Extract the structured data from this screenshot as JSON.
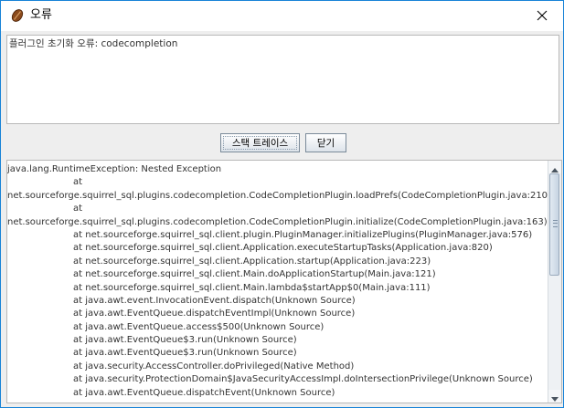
{
  "window": {
    "title": "오류",
    "icon": "coffee-bean-icon",
    "close": "close-icon"
  },
  "message": "플러그인 초기화 오류: codecompletion",
  "buttons": {
    "stack_trace": "스택 트레이스",
    "close": "닫기"
  },
  "trace": [
    {
      "text": "java.lang.RuntimeException: Nested Exception",
      "indent": false
    },
    {
      "text": "at",
      "indent": true
    },
    {
      "text": "net.sourceforge.squirrel_sql.plugins.codecompletion.CodeCompletionPlugin.loadPrefs(CodeCompletionPlugin.java:210)",
      "indent": false
    },
    {
      "text": "at",
      "indent": true
    },
    {
      "text": "net.sourceforge.squirrel_sql.plugins.codecompletion.CodeCompletionPlugin.initialize(CodeCompletionPlugin.java:163)",
      "indent": false
    },
    {
      "text": "at net.sourceforge.squirrel_sql.client.plugin.PluginManager.initializePlugins(PluginManager.java:576)",
      "indent": true
    },
    {
      "text": "at net.sourceforge.squirrel_sql.client.Application.executeStartupTasks(Application.java:820)",
      "indent": true
    },
    {
      "text": "at net.sourceforge.squirrel_sql.client.Application.startup(Application.java:223)",
      "indent": true
    },
    {
      "text": "at net.sourceforge.squirrel_sql.client.Main.doApplicationStartup(Main.java:121)",
      "indent": true
    },
    {
      "text": "at net.sourceforge.squirrel_sql.client.Main.lambda$startApp$0(Main.java:111)",
      "indent": true
    },
    {
      "text": "at java.awt.event.InvocationEvent.dispatch(Unknown Source)",
      "indent": true
    },
    {
      "text": "at java.awt.EventQueue.dispatchEventImpl(Unknown Source)",
      "indent": true
    },
    {
      "text": "at java.awt.EventQueue.access$500(Unknown Source)",
      "indent": true
    },
    {
      "text": "at java.awt.EventQueue$3.run(Unknown Source)",
      "indent": true
    },
    {
      "text": "at java.awt.EventQueue$3.run(Unknown Source)",
      "indent": true
    },
    {
      "text": "at java.security.AccessController.doPrivileged(Native Method)",
      "indent": true
    },
    {
      "text": "at java.security.ProtectionDomain$JavaSecurityAccessImpl.doIntersectionPrivilege(Unknown Source)",
      "indent": true
    },
    {
      "text": "at java.awt.EventQueue.dispatchEvent(Unknown Source)",
      "indent": true
    }
  ]
}
